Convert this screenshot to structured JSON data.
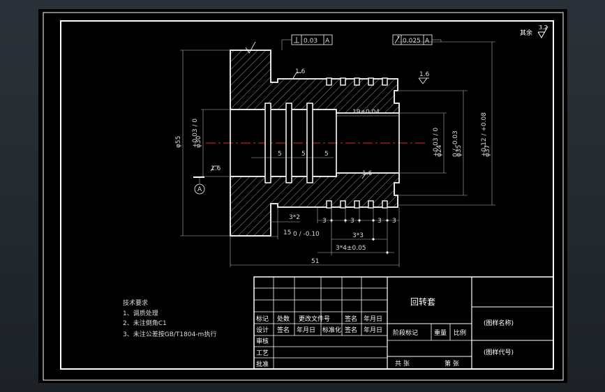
{
  "drawing": {
    "roughness_note": "其余",
    "roughness_value": "3.2",
    "tolerance_perpendicular": "0.03",
    "tolerance_perpendicular_datum": "A",
    "tolerance_runout": "0.025",
    "tolerance_runout_datum": "A",
    "roughness_left": "1.6",
    "roughness_right": "1.6",
    "roughness_bottom_bore": "1.6",
    "roughness_inner": "1.6",
    "datum_label": "A",
    "dims": {
      "d55": "φ55",
      "d30": "φ30",
      "d30_tol": "+0.03 / 0",
      "bore_len": "19±0.04",
      "d24": "φ24",
      "d24_tol": "+0.03 / 0",
      "d35": "φ35",
      "d35_tol": "0 / -0.03",
      "d37": "φ37",
      "d37_tol": "+0.12 / +0.08",
      "groove_left": "5",
      "groove_mid": "5",
      "groove_right": "5",
      "g_3x2": "3*2",
      "len_15": "15",
      "len_15_tol": "0 / -0.10",
      "g3_a": "3",
      "g3_b": "3",
      "g3_c": "3",
      "g3_d": "3",
      "len_3x3": "3*3",
      "len_3x4": "3*4±0.05",
      "len_51": "51"
    },
    "tech_req": {
      "title": "技术要求",
      "item1": "1、调质处理",
      "item2": "2、未注倒角C1",
      "item3": "3、未注公差按GB/T1804-m执行"
    }
  },
  "title_block": {
    "part_name": "回转套",
    "drawing_name": "(图样名称)",
    "drawing_code": "(图样代号)",
    "marker": "标记",
    "count": "处数",
    "change_doc": "更改文件号",
    "sign": "签名",
    "date": "年月日",
    "design": "设计",
    "sign2": "签名",
    "date2": "年月日",
    "standardize": "标准化",
    "sign3": "签名",
    "date3": "年月日",
    "review": "审核",
    "process": "工艺",
    "approve": "批准",
    "stage_mark": "阶段标记",
    "weight": "重量",
    "scale": "比例",
    "total": "共  张",
    "sheet": "第  张"
  }
}
